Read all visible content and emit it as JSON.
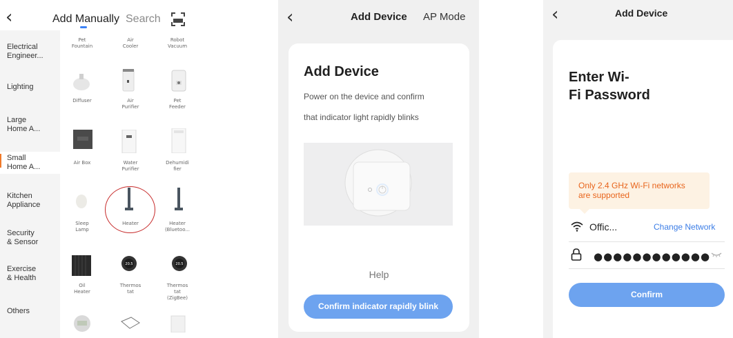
{
  "panel1": {
    "tabs": {
      "active": "Add Manually",
      "search": "Search"
    },
    "categories": [
      {
        "label": "Electrical\nEngineer..."
      },
      {
        "label": "Lighting"
      },
      {
        "label": "Large\nHome A..."
      },
      {
        "label": "Small\nHome A...",
        "active": true
      },
      {
        "label": "Kitchen\nAppliance"
      },
      {
        "label": "Security\n& Sensor"
      },
      {
        "label": "Exercise\n& Health"
      },
      {
        "label": "Others"
      }
    ],
    "devices": [
      "Pet\nFountain",
      "Air\nCooler",
      "Robot\nVacuum",
      "Diffuser",
      "Air\nPurifier",
      "Pet\nFeeder",
      "Air Box",
      "Water\nPurifier",
      "Dehumidi\nfier",
      "Sleep\nLamp",
      "Heater",
      "Heater\n(Bluetoo...",
      "Oil\nHeater",
      "Thermos\ntat",
      "Thermos\ntat\n(ZigBee)"
    ]
  },
  "panel2": {
    "header": {
      "title": "Add Device",
      "mode": "AP Mode"
    },
    "card": {
      "title": "Add Device",
      "line1": "Power on the device and confirm",
      "line2": "that indicator light rapidly blinks",
      "help": "Help",
      "confirm": "Confirm indicator rapidly blink"
    }
  },
  "panel3": {
    "header": {
      "title": "Add Device"
    },
    "card": {
      "title_line1": "Enter Wi-",
      "title_line2": "Fi Password",
      "warning": "Only 2.4 GHz Wi-Fi networks\nare supported",
      "ssid": "Offic...",
      "change_network": "Change Network",
      "password": "●●●●●●●●●●●●",
      "confirm": "Confirm"
    }
  },
  "colors": {
    "accent": "#6da3ef",
    "link": "#3b7de6",
    "warning": "#e8641b",
    "active_marker": "#f07a2a",
    "highlight_circle": "#c62828"
  }
}
